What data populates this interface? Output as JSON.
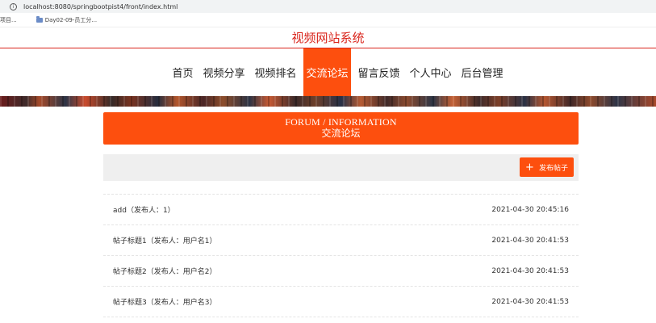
{
  "browser": {
    "url": "localhost:8080/springbootpist4/front/index.html",
    "bookmarks": [
      "项目...",
      "Day02-09-员工分..."
    ]
  },
  "site": {
    "title": "视频网站系统"
  },
  "nav": {
    "items": [
      {
        "label": "首页",
        "active": false
      },
      {
        "label": "视频分享",
        "active": false
      },
      {
        "label": "视频排名",
        "active": false
      },
      {
        "label": "交流论坛",
        "active": true
      },
      {
        "label": "留言反馈",
        "active": false
      },
      {
        "label": "个人中心",
        "active": false
      },
      {
        "label": "后台管理",
        "active": false
      }
    ]
  },
  "forum": {
    "heading_en": "FORUM / INFORMATION",
    "heading_cn": "交流论坛",
    "post_button": "发布帖子",
    "posts": [
      {
        "title": "add（发布人：1）",
        "time": "2021-04-30 20:45:16"
      },
      {
        "title": "帖子标题1（发布人：用户名1）",
        "time": "2021-04-30 20:41:53"
      },
      {
        "title": "帖子标题2（发布人：用户名2）",
        "time": "2021-04-30 20:41:53"
      },
      {
        "title": "帖子标题3（发布人：用户名3）",
        "time": "2021-04-30 20:41:53"
      }
    ]
  },
  "colors": {
    "accent": "#fd4f0e",
    "title_red": "#d9251c"
  }
}
